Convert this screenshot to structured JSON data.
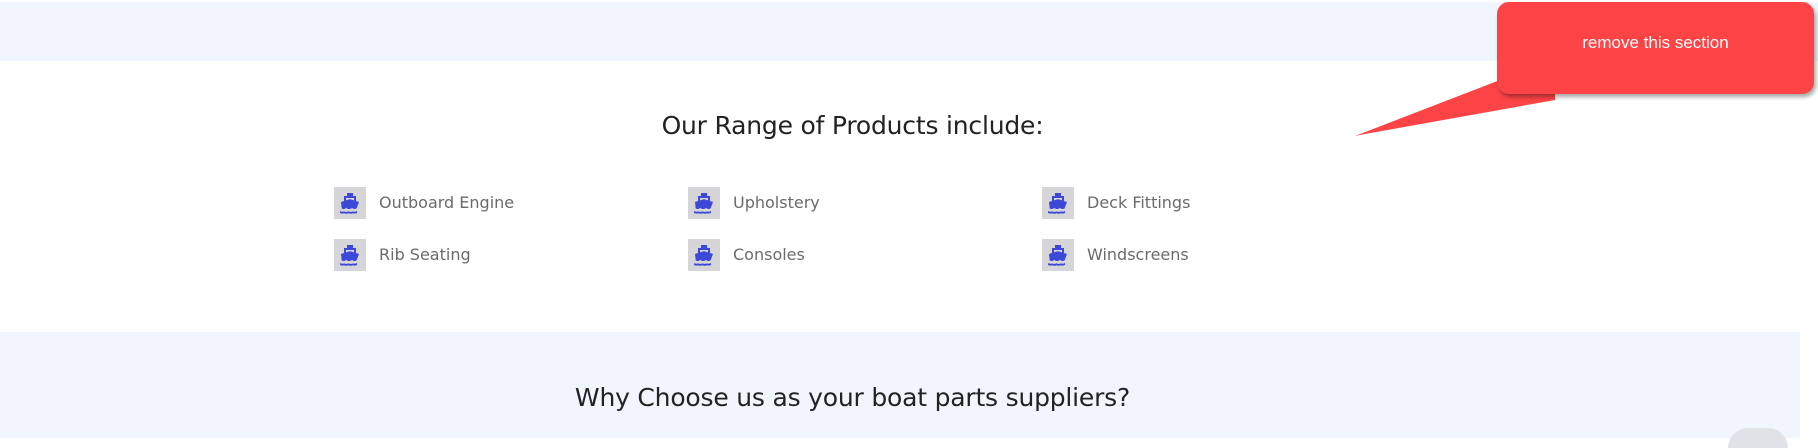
{
  "products_section": {
    "title": "Our Range of Products include:",
    "icon": "ship-icon",
    "icon_color": "#3d48d9",
    "items": [
      {
        "label": "Outboard Engine"
      },
      {
        "label": "Upholstery"
      },
      {
        "label": "Deck Fittings"
      },
      {
        "label": "Rib Seating"
      },
      {
        "label": "Consoles"
      },
      {
        "label": "Windscreens"
      }
    ]
  },
  "why_section": {
    "title": "Why Choose us as your boat parts suppliers?"
  },
  "annotation": {
    "text": "remove this section",
    "color": "#fc4446"
  },
  "colors": {
    "band_background": "#f0f5fe",
    "icon_tile": "#d6d6d9",
    "label_text": "#6b6b6b",
    "heading_text": "#222222"
  }
}
